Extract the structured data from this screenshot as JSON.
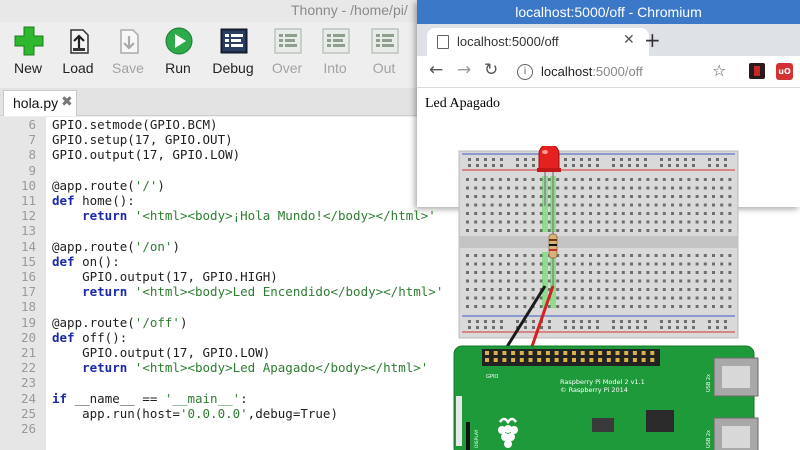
{
  "thonny": {
    "title": "Thonny  -  /home/pi/",
    "toolbar": [
      {
        "label": "New",
        "icon": "new-icon",
        "enabled": true
      },
      {
        "label": "Load",
        "icon": "load-icon",
        "enabled": true
      },
      {
        "label": "Save",
        "icon": "save-icon",
        "enabled": false
      },
      {
        "label": "Run",
        "icon": "run-icon",
        "enabled": true
      },
      {
        "label": "Debug",
        "icon": "debug-icon",
        "enabled": true
      },
      {
        "label": "Over",
        "icon": "step-over-icon",
        "enabled": false
      },
      {
        "label": "Into",
        "icon": "step-into-icon",
        "enabled": false
      },
      {
        "label": "Out",
        "icon": "step-out-icon",
        "enabled": false
      }
    ],
    "tab": {
      "label": "hola.py",
      "close": "✖"
    },
    "code_lines": [
      {
        "n": "6",
        "text": "GPIO.setmode(GPIO.BCM)"
      },
      {
        "n": "7",
        "text": "GPIO.setup(17, GPIO.OUT)"
      },
      {
        "n": "8",
        "text": "GPIO.output(17, GPIO.LOW)"
      },
      {
        "n": "9",
        "text": ""
      },
      {
        "n": "10",
        "text": "@app.route('/')"
      },
      {
        "n": "11",
        "text": "def home():"
      },
      {
        "n": "12",
        "text": "    return '<html><body>¡Hola Mundo!</body></html>'"
      },
      {
        "n": "13",
        "text": ""
      },
      {
        "n": "14",
        "text": "@app.route('/on')"
      },
      {
        "n": "15",
        "text": "def on():"
      },
      {
        "n": "16",
        "text": "    GPIO.output(17, GPIO.HIGH)"
      },
      {
        "n": "17",
        "text": "    return '<html><body>Led Encendido</body></html>'"
      },
      {
        "n": "18",
        "text": ""
      },
      {
        "n": "19",
        "text": "@app.route('/off')"
      },
      {
        "n": "20",
        "text": "def off():"
      },
      {
        "n": "21",
        "text": "    GPIO.output(17, GPIO.LOW)"
      },
      {
        "n": "22",
        "text": "    return '<html><body>Led Apagado</body></html>'"
      },
      {
        "n": "23",
        "text": ""
      },
      {
        "n": "24",
        "text": "if __name__ == '__main__':"
      },
      {
        "n": "25",
        "text": "    app.run(host='0.0.0.0',debug=True)"
      },
      {
        "n": "26",
        "text": ""
      }
    ]
  },
  "chromium": {
    "title": "localhost:5000/off - Chromium",
    "tab_label": "localhost:5000/off",
    "tab_close": "✕",
    "new_tab": "+",
    "url_host": "localhost",
    "url_path": ":5000/off",
    "page_text": "Led Apagado"
  },
  "board": {
    "gpio_label": "GPIO",
    "model_line1": "Raspberry Pi Model 2 v1.1",
    "model_line2": "© Raspberry Pi 2014",
    "usb_label_1": "USB 2x",
    "usb_label_2": "USB 2x",
    "display_label": "DISPLAY"
  },
  "colors": {
    "chromium_titlebar": "#3c78c8",
    "run_green": "#2eaa4a",
    "new_green": "#2fb82f",
    "pcb_green": "#1f9a3a",
    "led_red": "#e52020",
    "wire_black": "#1a1a1a",
    "wire_red": "#d42020"
  }
}
